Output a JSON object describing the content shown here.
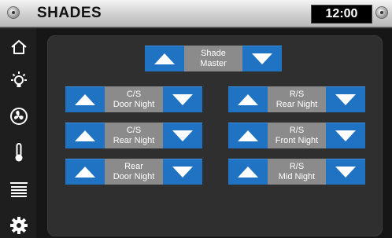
{
  "header": {
    "title": "SHADES",
    "time": "12:00"
  },
  "sidebar": {
    "items": [
      {
        "icon": "home-icon"
      },
      {
        "icon": "lightbulb-icon"
      },
      {
        "icon": "fan-icon"
      },
      {
        "icon": "thermometer-icon"
      },
      {
        "icon": "shades-icon"
      },
      {
        "icon": "gear-icon"
      }
    ]
  },
  "controls": {
    "master": {
      "line1": "Shade",
      "line2": "Master"
    },
    "cs_door": {
      "line1": "C/S",
      "line2": "Door Night"
    },
    "cs_rear": {
      "line1": "C/S",
      "line2": "Rear Night"
    },
    "rear_door": {
      "line1": "Rear",
      "line2": "Door Night"
    },
    "rs_rear": {
      "line1": "R/S",
      "line2": "Rear Night"
    },
    "rs_front": {
      "line1": "R/S",
      "line2": "Front Night"
    },
    "rs_mid": {
      "line1": "R/S",
      "line2": "Mid Night"
    }
  },
  "colors": {
    "accent": "#1f73c2",
    "label_bg": "#8b8b8b",
    "panel": "#2f2f2f"
  }
}
